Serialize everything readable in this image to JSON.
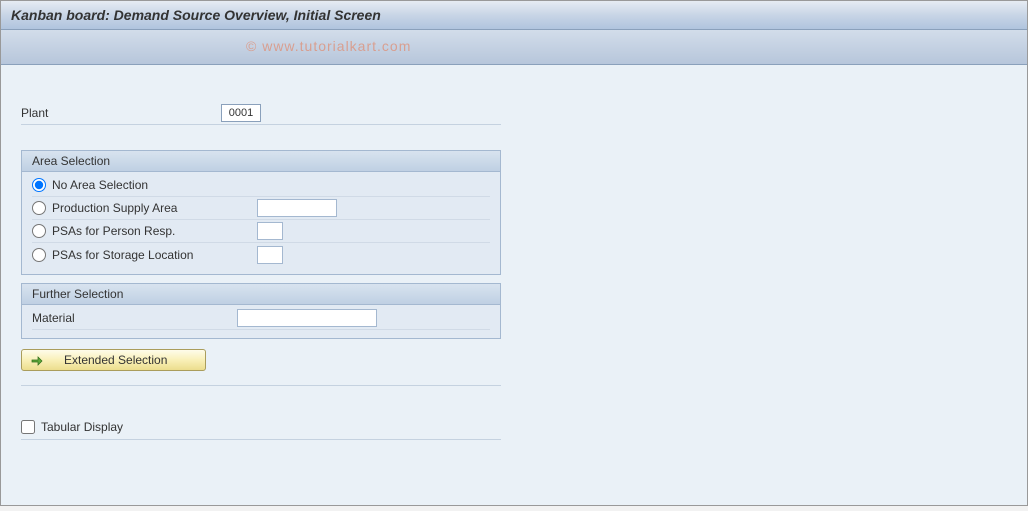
{
  "header": {
    "title": "Kanban board: Demand Source Overview, Initial Screen"
  },
  "watermark": "© www.tutorialkart.com",
  "plant": {
    "label": "Plant",
    "value": "0001"
  },
  "area_selection": {
    "title": "Area Selection",
    "radios": [
      {
        "label": "No Area Selection",
        "selected": true,
        "input_value": "",
        "has_input": false
      },
      {
        "label": "Production Supply Area",
        "selected": false,
        "input_value": "",
        "has_input": true,
        "input_size": "normal"
      },
      {
        "label": "PSAs for Person Resp.",
        "selected": false,
        "input_value": "",
        "has_input": true,
        "input_size": "small"
      },
      {
        "label": "PSAs for Storage Location",
        "selected": false,
        "input_value": "",
        "has_input": true,
        "input_size": "small"
      }
    ]
  },
  "further_selection": {
    "title": "Further Selection",
    "material": {
      "label": "Material",
      "value": ""
    }
  },
  "extended_selection_button": {
    "label": "Extended Selection",
    "icon": "execute-arrow-icon"
  },
  "tabular_display": {
    "label": "Tabular Display",
    "checked": false
  }
}
